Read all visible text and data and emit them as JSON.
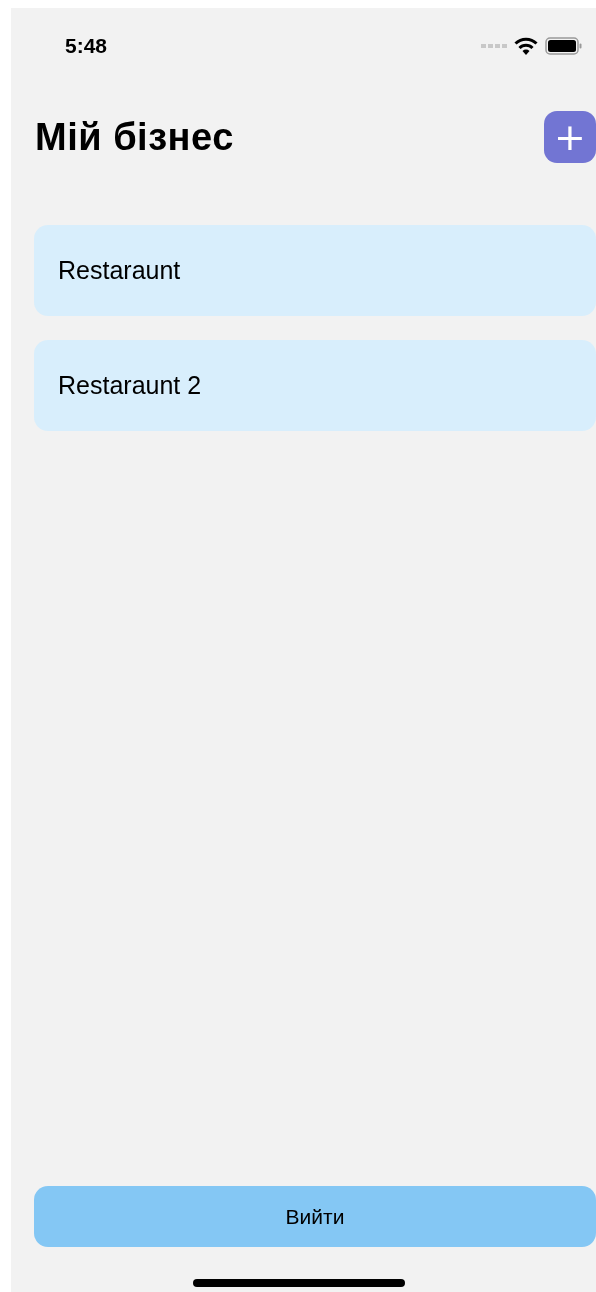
{
  "status_bar": {
    "time": "5:48"
  },
  "header": {
    "title": "Мій бізнес",
    "add_button": "+"
  },
  "businesses": [
    {
      "name": "Restaraunt"
    },
    {
      "name": "Restaraunt 2"
    }
  ],
  "logout_button": "Вийти"
}
